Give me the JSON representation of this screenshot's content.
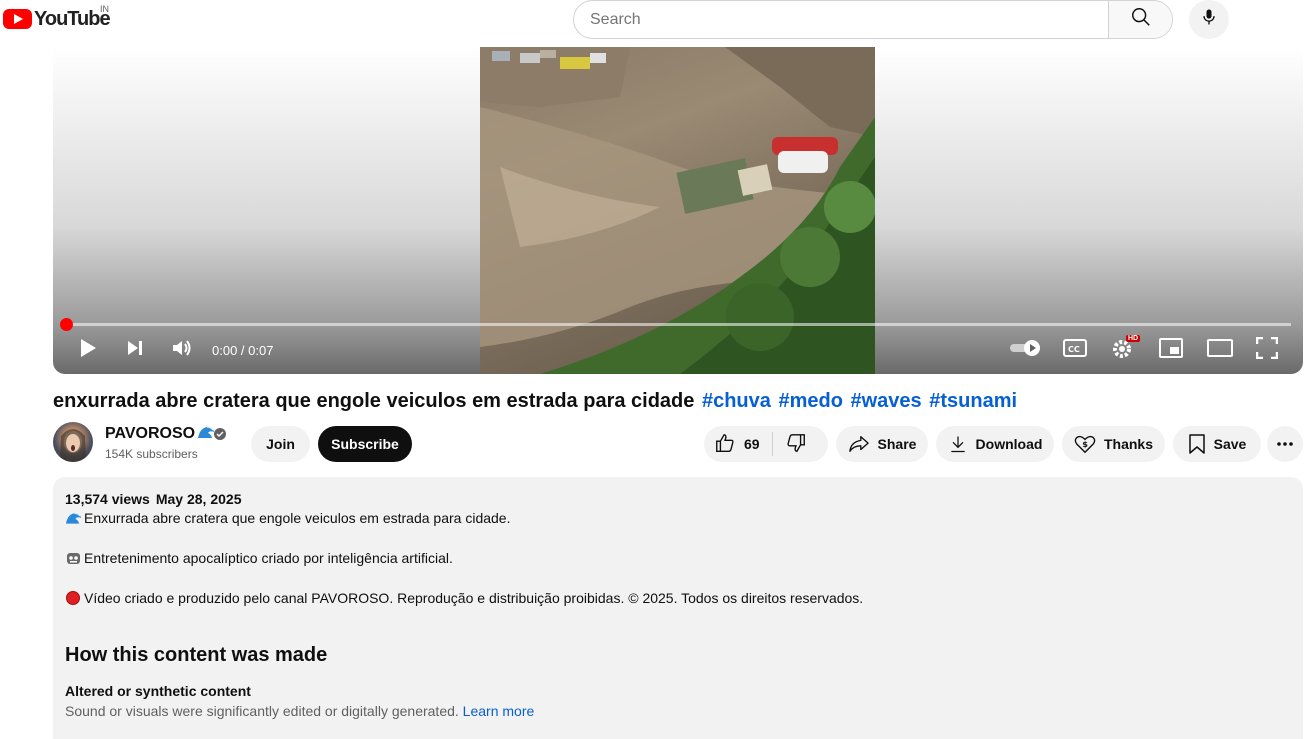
{
  "header": {
    "logo_text": "YouTube",
    "country_code": "IN",
    "search": {
      "placeholder": "Search",
      "value": ""
    }
  },
  "player": {
    "time_display": "0:00 / 0:07",
    "progress": 0.0,
    "hd_badge": "HD",
    "colors": {
      "progress": "#ff0000"
    }
  },
  "video": {
    "title": "enxurrada abre cratera que engole veiculos em estrada para cidade",
    "hashtags": [
      "#chuva",
      "#medo",
      "#waves",
      "#tsunami"
    ]
  },
  "channel": {
    "name": "PAVOROSO",
    "subscribers": "154K subscribers",
    "join_label": "Join",
    "subscribe_label": "Subscribe"
  },
  "actions": {
    "like_count": "69",
    "share_label": "Share",
    "download_label": "Download",
    "thanks_label": "Thanks",
    "save_label": "Save"
  },
  "description": {
    "views": "13,574 views",
    "date": "May 28, 2025",
    "lines": [
      "Enxurrada abre cratera que engole veiculos em estrada para cidade.",
      "Entretenimento apocalíptico criado por inteligência artificial.",
      "Vídeo criado e produzido pelo canal PAVOROSO. Reprodução e distribuição proibidas. © 2025. Todos os direitos reservados."
    ],
    "how_made_heading": "How this content was made",
    "altered_title": "Altered or synthetic content",
    "altered_desc": "Sound or visuals were significantly edited or digitally generated.",
    "learn_more": "Learn more"
  },
  "icons": [
    "wave-icon",
    "robot-face-icon",
    "red-circle-icon",
    "verified-icon",
    "like-icon",
    "dislike-icon",
    "share-icon",
    "download-icon",
    "thanks-icon",
    "save-icon",
    "more-icon",
    "search-icon",
    "mic-icon",
    "play-icon",
    "next-icon",
    "volume-icon",
    "autoplay-toggle-icon",
    "captions-icon",
    "settings-icon",
    "miniplayer-icon",
    "theater-icon",
    "fullscreen-icon"
  ]
}
